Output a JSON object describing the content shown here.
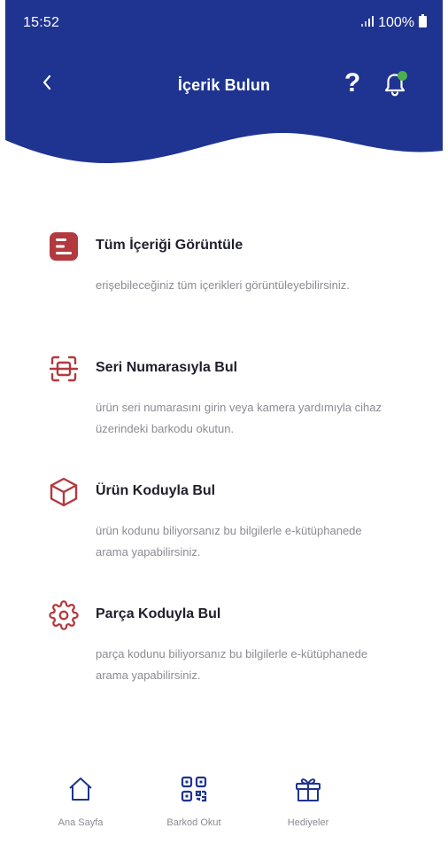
{
  "status_bar": {
    "time": "15:52",
    "battery": "100%"
  },
  "header": {
    "title": "İçerik Bulun",
    "help_label": "?"
  },
  "menu": {
    "items": [
      {
        "icon": "document-list-icon",
        "title": "Tüm İçeriği Görüntüle",
        "description": "erişebileceğiniz tüm içerikleri görüntüleyebilirsiniz."
      },
      {
        "icon": "barcode-scan-icon",
        "title": "Seri Numarasıyla Bul",
        "description": "ürün seri numarasını girin veya kamera yardımıyla cihaz üzerindeki barkodu okutun."
      },
      {
        "icon": "cube-icon",
        "title": "Ürün Koduyla Bul",
        "description": "ürün kodunu biliyorsanız bu bilgilerle e-kütüphanede arama yapabilirsiniz."
      },
      {
        "icon": "gear-icon",
        "title": "Parça Koduyla Bul",
        "description": "parça kodunu biliyorsanız bu bilgilerle e-kütüphanede arama yapabilirsiniz."
      }
    ]
  },
  "bottom_nav": {
    "items": [
      {
        "icon": "home-icon",
        "label": "Ana Sayfa"
      },
      {
        "icon": "qr-code-icon",
        "label": "Barkod Okut"
      },
      {
        "icon": "gift-icon",
        "label": "Hediyeler"
      }
    ]
  },
  "colors": {
    "header_blue": "#1f3490",
    "accent_red": "#b23a3e",
    "notification_green": "#4caf50",
    "text_dark": "#1f1f2b",
    "text_muted": "#8b8b92"
  }
}
